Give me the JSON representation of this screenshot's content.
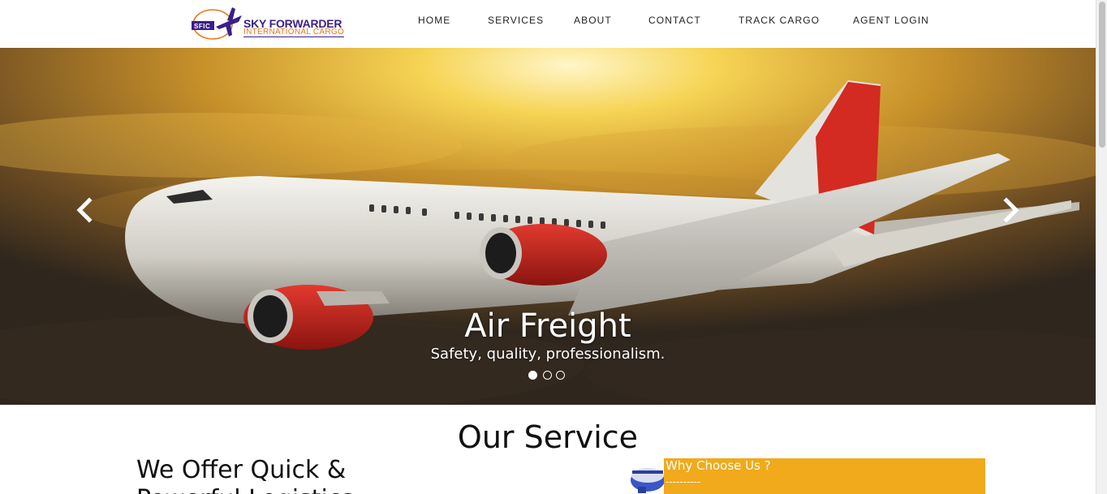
{
  "logo": {
    "badge": "SFIC",
    "line1": "SKY FORWARDER",
    "line2": "INTERNATIONAL CARGO"
  },
  "nav": {
    "items": [
      "HOME",
      "SERVICES",
      "ABOUT",
      "CONTACT",
      "TRACK CARGO",
      "AGENT LOGIN"
    ]
  },
  "hero": {
    "title": "Air Freight",
    "subtitle": "Safety, quality, professionalism.",
    "slide_count": 3,
    "active_slide": 1
  },
  "service": {
    "section_title": "Our Service",
    "offer_heading": "We Offer Quick & Powerful Logistics",
    "why_title": "Why Choose Us ?",
    "why_divider": "----------"
  },
  "colors": {
    "logo_purple": "#3a1f8a",
    "logo_orange": "#e8761a",
    "accent_yellow": "#f0aa1b"
  }
}
